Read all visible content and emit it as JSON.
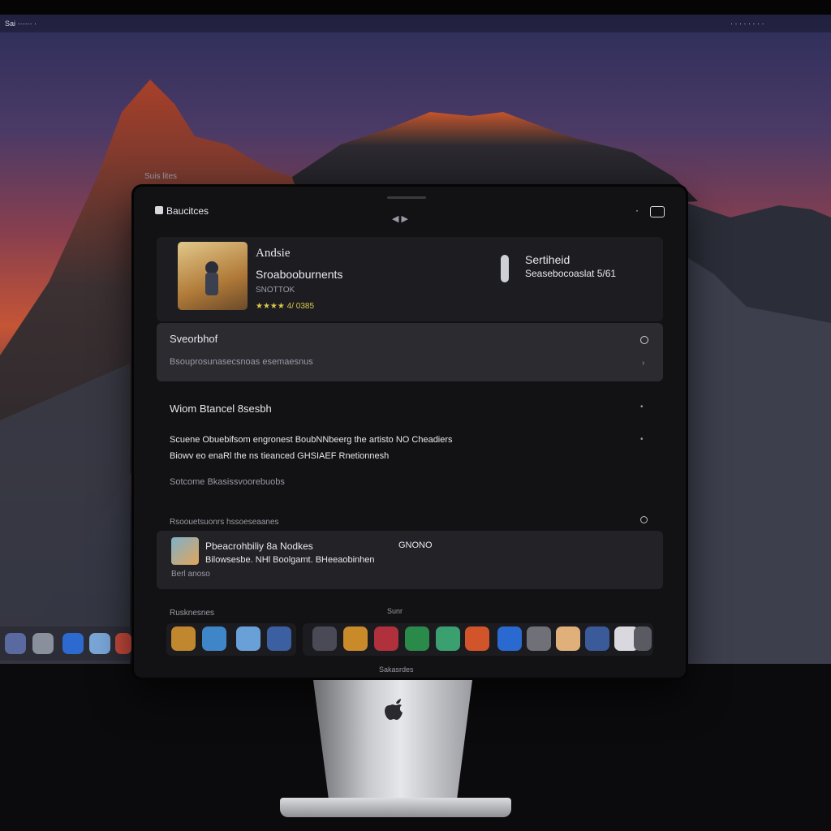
{
  "menubar": {
    "left_text": "Sai  ······  ·",
    "right_text": "· · · · ·  ·  · ·"
  },
  "desktop_label": "Suis lites",
  "window": {
    "title": "Baucitces",
    "center_control": "◀ ▶",
    "bottom_label": "Sakasrdes"
  },
  "now_playing": {
    "title": "Andsie",
    "subtitle": "Sroabooburnents",
    "meta": "SNOTTOK",
    "rating": "★★★★ 4/ 0385",
    "side_title": "Sertiheid",
    "side_subtitle": "Seasebocoaslat 5/61"
  },
  "search_section": {
    "title": "Sveorbhof",
    "description": "Bsouprosunasecsnoas esemaesnus"
  },
  "detail": {
    "heading": "Wiom Btancel 8sesbh",
    "line1": "Scuene Obuebifsom engronest BoubNNbeerg the artisto NO Cheadiers",
    "line2": "Biowv eo enaRl the ns tieanced GHSIAEF Rnetionnesh",
    "footer": "Sotcome Bkasissvoorebuobs"
  },
  "recent": {
    "header": "Rsoouetsuonrs hssoeseaanes",
    "item_title": "Pbeacrohbiliy 8a Nodkes",
    "item_sub": "Bilowsesbe. NHl Boolgamt. BHeeaobinhen",
    "item_badge": "GNONO",
    "item_meta": "Berl anoso"
  },
  "dock": {
    "label": "Rusknesnes",
    "count_label": "Sunr"
  },
  "colors": {
    "accent_rating": "#d9c74a",
    "window_bg": "#121214",
    "card_bg": "#2a2a2e"
  }
}
